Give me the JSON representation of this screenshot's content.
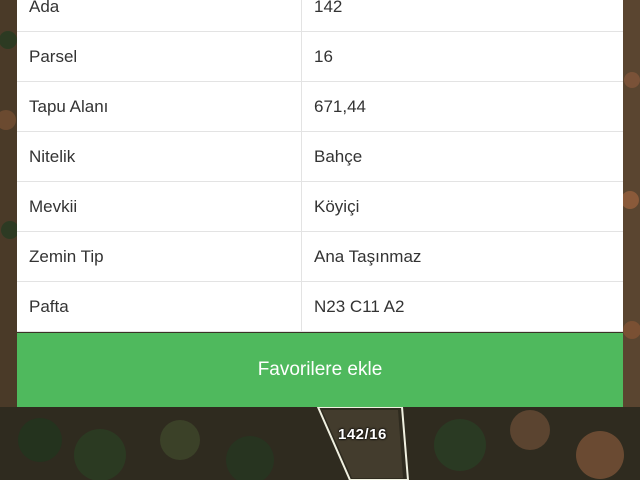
{
  "details": {
    "rows": [
      {
        "key": "Ada",
        "value": "142"
      },
      {
        "key": "Parsel",
        "value": "16"
      },
      {
        "key": "Tapu Alanı",
        "value": "671,44"
      },
      {
        "key": "Nitelik",
        "value": "Bahçe"
      },
      {
        "key": "Mevkii",
        "value": "Köyiçi"
      },
      {
        "key": "Zemin Tip",
        "value": "Ana Taşınmaz"
      },
      {
        "key": "Pafta",
        "value": "N23 C11 A2"
      }
    ]
  },
  "actions": {
    "favorite_label": "Favorilere ekle"
  },
  "map": {
    "parcel_label": "142/16"
  },
  "colors": {
    "button_green": "#4fb95d",
    "card_bg": "#ffffff",
    "map_dark": "#3b3326"
  }
}
